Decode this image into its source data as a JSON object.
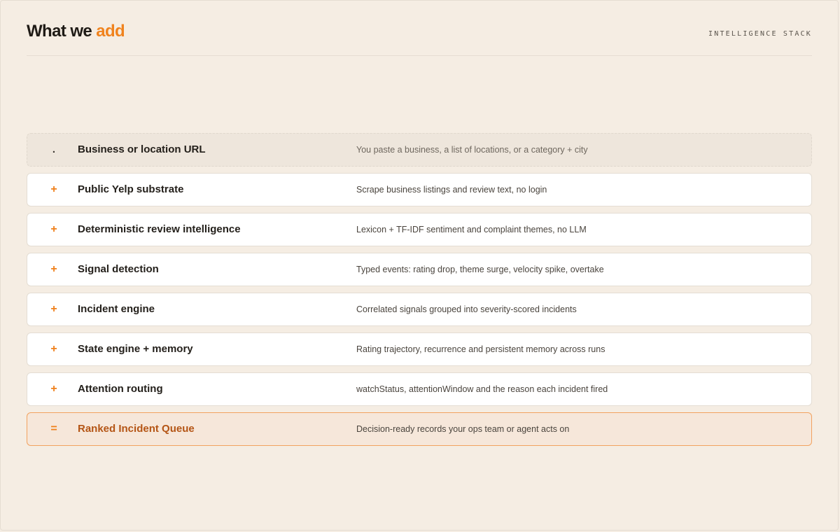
{
  "header": {
    "title_main": "What we",
    "title_accent": "add",
    "kicker": "INTELLIGENCE STACK"
  },
  "stack": {
    "rows": [
      {
        "symbol": ".",
        "name": "Business or location URL",
        "desc": "You paste a business, a list of locations, or a category + city"
      },
      {
        "symbol": "+",
        "name": "Public Yelp substrate",
        "desc": "Scrape business listings and review text, no login"
      },
      {
        "symbol": "+",
        "name": "Deterministic review intelligence",
        "desc": "Lexicon + TF-IDF sentiment and complaint themes, no LLM"
      },
      {
        "symbol": "+",
        "name": "Signal detection",
        "desc": "Typed events: rating drop, theme surge, velocity spike, overtake"
      },
      {
        "symbol": "+",
        "name": "Incident engine",
        "desc": "Correlated signals grouped into severity-scored incidents"
      },
      {
        "symbol": "+",
        "name": "State engine + memory",
        "desc": "Rating trajectory, recurrence and persistent memory across runs"
      },
      {
        "symbol": "+",
        "name": "Attention routing",
        "desc": "watchStatus, attentionWindow and the reason each incident fired"
      },
      {
        "symbol": "=",
        "name": "Ranked Incident Queue",
        "desc": "Decision-ready records your ops team or agent acts on"
      }
    ]
  },
  "colors": {
    "accent": "#f0831e",
    "background": "#f5ede3",
    "result_text": "#b45515"
  }
}
